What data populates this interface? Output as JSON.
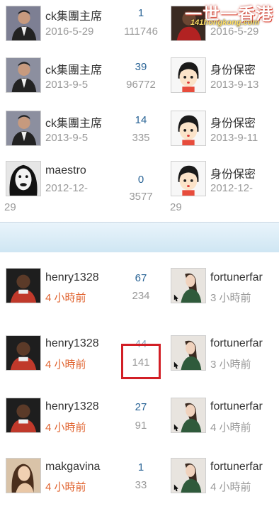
{
  "threads": [
    {
      "author": "ck集團主席",
      "date": "2016-5-29",
      "replies": "1",
      "views": "111746",
      "last_author": "",
      "last_date": "2016-5-29",
      "author_avatar": "businessman",
      "last_avatar": "dark-man"
    },
    {
      "author": "ck集團主席",
      "date": "2013-9-5",
      "replies": "39",
      "views": "96772",
      "last_author": "身份保密",
      "last_date": "2013-9-13",
      "author_avatar": "businessman",
      "last_avatar": "cartoon-face"
    },
    {
      "author": "ck集團主席",
      "date": "2013-9-5",
      "replies": "14",
      "views": "335",
      "last_author": "身份保密",
      "last_date": "2013-9-11",
      "author_avatar": "businessman",
      "last_avatar": "cartoon-face"
    },
    {
      "author": "maestro",
      "date_line1": "2012-12-",
      "date_line2": "29",
      "replies": "0",
      "views": "3577",
      "last_author": "身份保密",
      "last_date_line1": "2012-12-",
      "last_date_line2": "29",
      "author_avatar": "woman-black-lips",
      "last_avatar": "cartoon-face"
    },
    {
      "author": "henry1328",
      "date": "4 小時前",
      "replies": "67",
      "views": "234",
      "last_author": "fortunerfar",
      "last_date": "3 小時前",
      "author_avatar": "footballer",
      "last_avatar": "model-photo"
    },
    {
      "author": "henry1328",
      "date": "4 小時前",
      "replies": "44",
      "views": "141",
      "last_author": "fortunerfar",
      "last_date": "3 小時前",
      "author_avatar": "footballer",
      "last_avatar": "model-photo"
    },
    {
      "author": "henry1328",
      "date": "4 小時前",
      "replies": "27",
      "views": "91",
      "last_author": "fortunerfar",
      "last_date": "4 小時前",
      "author_avatar": "footballer",
      "last_avatar": "model-photo"
    },
    {
      "author": "makgavina",
      "date": "4 小時前",
      "replies": "1",
      "views": "33",
      "last_author": "fortunerfar",
      "last_date": "4 小時前",
      "author_avatar": "woman-portrait",
      "last_avatar": "model-photo"
    }
  ],
  "watermark": {
    "main": "一世一香港",
    "sub": "141hongkong.com"
  },
  "colors": {
    "recent_date": "#e0632f",
    "replies": "#2a6496",
    "highlight": "#d21f26"
  }
}
